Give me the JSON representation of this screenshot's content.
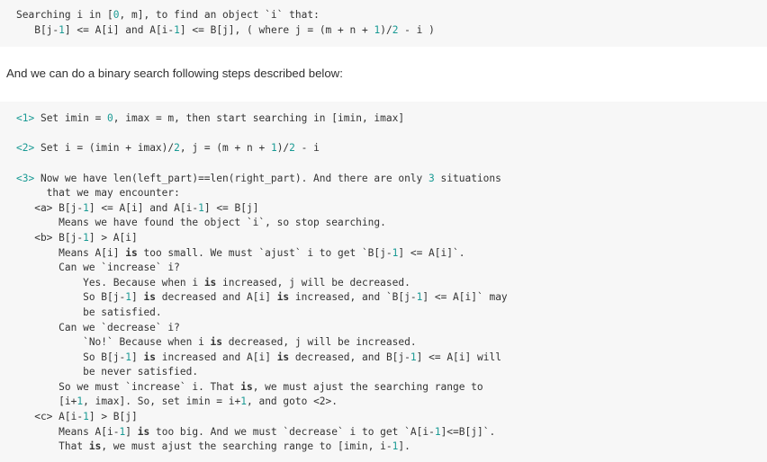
{
  "document": {
    "top_code_block": {
      "language": "text",
      "lines": [
        [
          {
            "t": "Searching i in [",
            "c": "plain"
          },
          {
            "t": "0",
            "c": "num"
          },
          {
            "t": ", m], to find an object `i` that:",
            "c": "plain"
          }
        ],
        [
          {
            "t": "   B[j-",
            "c": "plain"
          },
          {
            "t": "1",
            "c": "num"
          },
          {
            "t": "] <= A[i] and A[i-",
            "c": "plain"
          },
          {
            "t": "1",
            "c": "num"
          },
          {
            "t": "] <= B[j], ( where j = (m + n + ",
            "c": "plain"
          },
          {
            "t": "1",
            "c": "num"
          },
          {
            "t": ")/",
            "c": "plain"
          },
          {
            "t": "2",
            "c": "num"
          },
          {
            "t": " - i )",
            "c": "plain"
          }
        ]
      ]
    },
    "paragraph": "And we can do a binary search following steps described below:",
    "main_code_block": {
      "language": "text",
      "lines": [
        [
          {
            "t": "<1>",
            "c": "mark"
          },
          {
            "t": " Set imin = ",
            "c": "plain"
          },
          {
            "t": "0",
            "c": "num"
          },
          {
            "t": ", imax = m, then start searching in [imin, imax]",
            "c": "plain"
          }
        ],
        [],
        [
          {
            "t": "<2>",
            "c": "mark"
          },
          {
            "t": " Set i = (imin + imax)/",
            "c": "plain"
          },
          {
            "t": "2",
            "c": "num"
          },
          {
            "t": ", j = (m + n + ",
            "c": "plain"
          },
          {
            "t": "1",
            "c": "num"
          },
          {
            "t": ")/",
            "c": "plain"
          },
          {
            "t": "2",
            "c": "num"
          },
          {
            "t": " - i",
            "c": "plain"
          }
        ],
        [],
        [
          {
            "t": "<3>",
            "c": "mark"
          },
          {
            "t": " Now we have len(left_part)==len(right_part). And there are only ",
            "c": "plain"
          },
          {
            "t": "3",
            "c": "num"
          },
          {
            "t": " situations",
            "c": "plain"
          }
        ],
        [
          {
            "t": "     that we may encounter:",
            "c": "plain"
          }
        ],
        [
          {
            "t": "   <a> B[j-",
            "c": "plain"
          },
          {
            "t": "1",
            "c": "num"
          },
          {
            "t": "] <= A[i] and A[i-",
            "c": "plain"
          },
          {
            "t": "1",
            "c": "num"
          },
          {
            "t": "] <= B[j]",
            "c": "plain"
          }
        ],
        [
          {
            "t": "       Means we have found the object `i`, so stop searching.",
            "c": "plain"
          }
        ],
        [
          {
            "t": "   <b> B[j-",
            "c": "plain"
          },
          {
            "t": "1",
            "c": "num"
          },
          {
            "t": "] > A[i]",
            "c": "plain"
          }
        ],
        [
          {
            "t": "       Means A[i] ",
            "c": "plain"
          },
          {
            "t": "is",
            "c": "kw"
          },
          {
            "t": " too small. We must `ajust` i to get `B[j-",
            "c": "plain"
          },
          {
            "t": "1",
            "c": "num"
          },
          {
            "t": "] <= A[i]`.",
            "c": "plain"
          }
        ],
        [
          {
            "t": "       Can we `increase` i?",
            "c": "plain"
          }
        ],
        [
          {
            "t": "           Yes. Because when i ",
            "c": "plain"
          },
          {
            "t": "is",
            "c": "kw"
          },
          {
            "t": " increased, j will be decreased.",
            "c": "plain"
          }
        ],
        [
          {
            "t": "           So B[j-",
            "c": "plain"
          },
          {
            "t": "1",
            "c": "num"
          },
          {
            "t": "] ",
            "c": "plain"
          },
          {
            "t": "is",
            "c": "kw"
          },
          {
            "t": " decreased and A[i] ",
            "c": "plain"
          },
          {
            "t": "is",
            "c": "kw"
          },
          {
            "t": " increased, and `B[j-",
            "c": "plain"
          },
          {
            "t": "1",
            "c": "num"
          },
          {
            "t": "] <= A[i]` may",
            "c": "plain"
          }
        ],
        [
          {
            "t": "           be satisfied.",
            "c": "plain"
          }
        ],
        [
          {
            "t": "       Can we `decrease` i?",
            "c": "plain"
          }
        ],
        [
          {
            "t": "           `No!` Because when i ",
            "c": "plain"
          },
          {
            "t": "is",
            "c": "kw"
          },
          {
            "t": " decreased, j will be increased.",
            "c": "plain"
          }
        ],
        [
          {
            "t": "           So B[j-",
            "c": "plain"
          },
          {
            "t": "1",
            "c": "num"
          },
          {
            "t": "] ",
            "c": "plain"
          },
          {
            "t": "is",
            "c": "kw"
          },
          {
            "t": " increased and A[i] ",
            "c": "plain"
          },
          {
            "t": "is",
            "c": "kw"
          },
          {
            "t": " decreased, and B[j-",
            "c": "plain"
          },
          {
            "t": "1",
            "c": "num"
          },
          {
            "t": "] <= A[i] will",
            "c": "plain"
          }
        ],
        [
          {
            "t": "           be never satisfied.",
            "c": "plain"
          }
        ],
        [
          {
            "t": "       So we must `increase` i. That ",
            "c": "plain"
          },
          {
            "t": "is",
            "c": "kw"
          },
          {
            "t": ", we must ajust the searching range to",
            "c": "plain"
          }
        ],
        [
          {
            "t": "       [i+",
            "c": "plain"
          },
          {
            "t": "1",
            "c": "num"
          },
          {
            "t": ", imax]. So, set imin = i+",
            "c": "plain"
          },
          {
            "t": "1",
            "c": "num"
          },
          {
            "t": ", and goto <2>.",
            "c": "plain"
          }
        ],
        [
          {
            "t": "   <c> A[i-",
            "c": "plain"
          },
          {
            "t": "1",
            "c": "num"
          },
          {
            "t": "] > B[j]",
            "c": "plain"
          }
        ],
        [
          {
            "t": "       Means A[i-",
            "c": "plain"
          },
          {
            "t": "1",
            "c": "num"
          },
          {
            "t": "] ",
            "c": "plain"
          },
          {
            "t": "is",
            "c": "kw"
          },
          {
            "t": " too big. And we must `decrease` i to get `A[i-",
            "c": "plain"
          },
          {
            "t": "1",
            "c": "num"
          },
          {
            "t": "]<=B[j]`.",
            "c": "plain"
          }
        ],
        [
          {
            "t": "       That ",
            "c": "plain"
          },
          {
            "t": "is",
            "c": "kw"
          },
          {
            "t": ", we must ajust the searching range to [imin, i-",
            "c": "plain"
          },
          {
            "t": "1",
            "c": "num"
          },
          {
            "t": "].",
            "c": "plain"
          }
        ]
      ]
    }
  },
  "theme": {
    "code_background": "#f7f7f7",
    "code_text": "#333333",
    "number_color": "#1a9a94",
    "marker_color": "#1a9a94",
    "page_background": "#ffffff",
    "prose_color": "#2f2f2f"
  }
}
